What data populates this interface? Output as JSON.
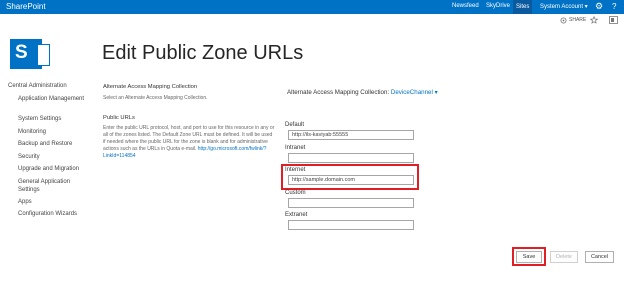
{
  "topbar": {
    "brand": "SharePoint",
    "links": [
      "Newsfeed",
      "SkyDrive",
      "Sites"
    ],
    "account": "System Account ▾",
    "settings_glyph": "⚙",
    "help_glyph": "?"
  },
  "subbar": {
    "share_label": "SHARE"
  },
  "page": {
    "title": "Edit Public Zone URLs"
  },
  "leftnav": {
    "heading": "Central Administration",
    "items": [
      "Application Management",
      "System Settings",
      "Monitoring",
      "Backup and Restore",
      "Security",
      "Upgrade and Migration",
      "General Application Settings",
      "Apps",
      "Configuration Wizards"
    ]
  },
  "mapping_section": {
    "title": "Alternate Access Mapping Collection",
    "description": "Select an Alternate Access Mapping Collection.",
    "label": "Alternate Access Mapping Collection:",
    "value": "DeviceChannel ▾"
  },
  "public_urls": {
    "title": "Public URLs",
    "description": "Enter the public URL protocol, host, and port to use for this resource in any or all of the zones listed. The Default Zone URL must be defined. It will be used if needed where the public URL for the zone is blank and for administrative actions such as the URLs in Quota e-mail.",
    "link": "http://go.microsoft.com/fwlink/?LinkId=114854"
  },
  "fields": {
    "default": {
      "label": "Default",
      "value": "http://ils-kaviyab:55555"
    },
    "intranet": {
      "label": "Intranet",
      "value": ""
    },
    "internet": {
      "label": "Internet",
      "value": "http://sample.domain.com"
    },
    "custom": {
      "label": "Custom",
      "value": ""
    },
    "extranet": {
      "label": "Extranet",
      "value": ""
    }
  },
  "buttons": {
    "save": "Save",
    "delete": "Delete",
    "cancel": "Cancel"
  },
  "colors": {
    "brand_blue": "#0072c6",
    "highlight_red": "#e01e26"
  }
}
